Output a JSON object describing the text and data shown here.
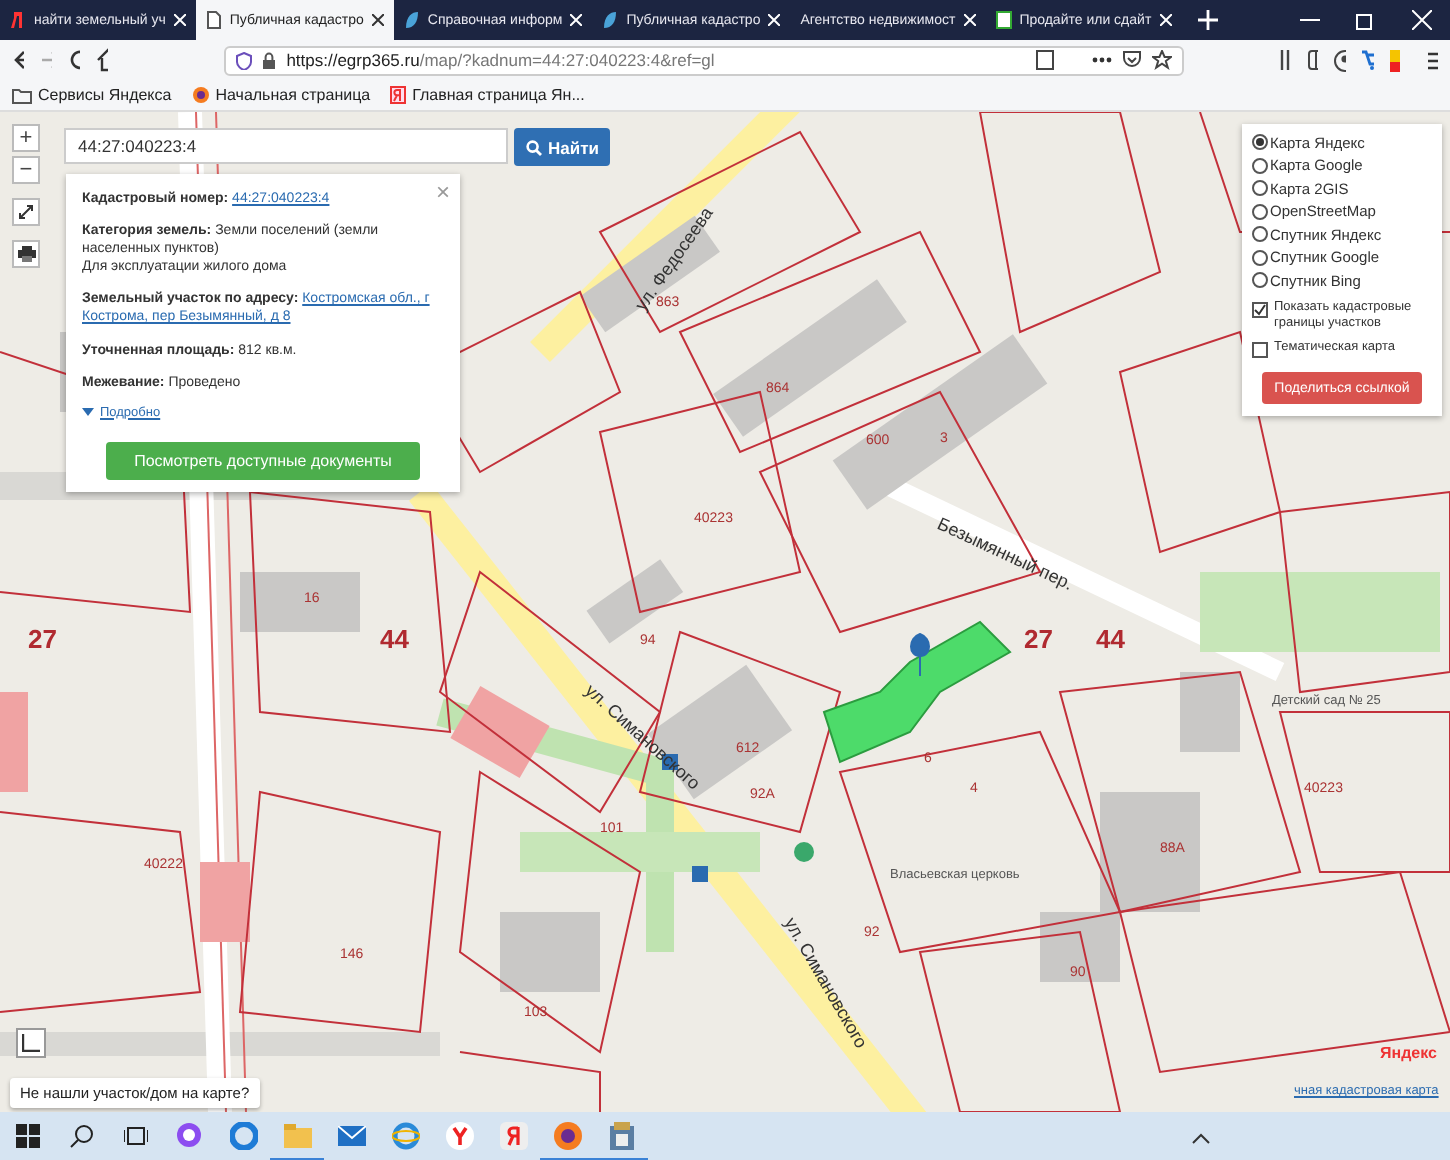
{
  "browser": {
    "tabs": [
      {
        "label": "найти земельный уч",
        "selected": false
      },
      {
        "label": "Публичная кадастро",
        "selected": true
      },
      {
        "label": "Справочная информ",
        "selected": false
      },
      {
        "label": "Публичная кадастро",
        "selected": false
      },
      {
        "label": "Агентство недвижимост",
        "selected": false
      },
      {
        "label": "Продайте или сдайт",
        "selected": false
      }
    ],
    "url_host": "https://egrp365.ru",
    "url_rest": "/map/?kadnum=44:27:040223:4&ref=gl",
    "bookmarks": [
      "Сервисы Яндекса",
      "Начальная страница",
      "Главная страница Ян..."
    ]
  },
  "map": {
    "zoom_in": "+",
    "zoom_out": "−",
    "labels": [
      {
        "text": "ул. Федосеева",
        "kind": "street"
      },
      {
        "text": "863",
        "kind": "number"
      },
      {
        "text": "864",
        "kind": "number"
      },
      {
        "text": "600",
        "kind": "number"
      },
      {
        "text": "3",
        "kind": "number"
      },
      {
        "text": "40223",
        "kind": "number"
      },
      {
        "text": "Безымянный пер.",
        "kind": "street"
      },
      {
        "text": "16",
        "kind": "number"
      },
      {
        "text": "27",
        "kind": "big"
      },
      {
        "text": "44",
        "kind": "big"
      },
      {
        "text": "94",
        "kind": "number"
      },
      {
        "text": "27",
        "kind": "big"
      },
      {
        "text": "44",
        "kind": "big"
      },
      {
        "text": "ул. Симановского",
        "kind": "street"
      },
      {
        "text": "Детский сад № 25",
        "kind": "poi"
      },
      {
        "text": "612",
        "kind": "number"
      },
      {
        "text": "6",
        "kind": "number"
      },
      {
        "text": "92А",
        "kind": "number"
      },
      {
        "text": "4",
        "kind": "number"
      },
      {
        "text": "40223",
        "kind": "number"
      },
      {
        "text": "101",
        "kind": "number"
      },
      {
        "text": "88А",
        "kind": "number"
      },
      {
        "text": "40222",
        "kind": "number"
      },
      {
        "text": "Власьевская церковь",
        "kind": "poi"
      },
      {
        "text": "ул. Симановского",
        "kind": "street"
      },
      {
        "text": "92",
        "kind": "number"
      },
      {
        "text": "146",
        "kind": "number"
      },
      {
        "text": "90",
        "kind": "number"
      },
      {
        "text": "103",
        "kind": "number"
      }
    ]
  },
  "search": {
    "value": "44:27:040223:4",
    "button": "Найти"
  },
  "info": {
    "close": "×",
    "fields": [
      {
        "label": "Кадастровый номер:",
        "value": "44:27:040223:4",
        "kind": "link"
      },
      {
        "label": "Категория земель:",
        "value": "Земли поселений (земли населенных пунктов)",
        "note": "Для эксплуатации жилого дома",
        "kind": "text"
      },
      {
        "label": "Земельный участок по адресу:",
        "value": "Костромская обл., г Кострома, пер Безымянный, д 8",
        "kind": "link"
      },
      {
        "label": "Уточненная площадь:",
        "value": "812 кв.м.",
        "kind": "text"
      },
      {
        "label": "Межевание:",
        "value": "Проведено",
        "kind": "text"
      }
    ],
    "more": "Подробно",
    "button": "Посмотреть доступные документы"
  },
  "layers": {
    "options": [
      {
        "label": "Карта Яндекс",
        "selected": true
      },
      {
        "label": "Карта Google",
        "selected": false
      },
      {
        "label": "Карта 2GIS",
        "selected": false
      },
      {
        "label": "OpenStreetMap",
        "selected": false
      },
      {
        "label": "Спутник Яндекс",
        "selected": false
      },
      {
        "label": "Спутник Google",
        "selected": false
      },
      {
        "label": "Спутник Bing",
        "selected": false
      }
    ],
    "checks": [
      {
        "label": "Показать кадастровые границы участков",
        "checked": true
      },
      {
        "label": "Тематическая карта",
        "checked": false
      }
    ],
    "button": "Поделиться ссылкой"
  },
  "help_tip": "Не нашли участок/дом на карте?",
  "attribution": {
    "logo": "Яндекс",
    "link": "чная кадастровая карта"
  },
  "taskbar": {
    "apps": [
      {
        "kind": "edge",
        "open": false
      },
      {
        "kind": "explorer",
        "open": true
      },
      {
        "kind": "mail",
        "open": false
      },
      {
        "kind": "ie",
        "open": false
      },
      {
        "kind": "yandex",
        "open": false
      },
      {
        "kind": "yabrowser",
        "open": false
      },
      {
        "kind": "firefox",
        "open": true
      },
      {
        "kind": "archive",
        "open": true
      }
    ]
  }
}
